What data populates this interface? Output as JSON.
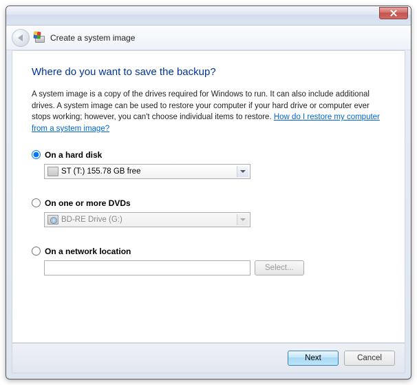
{
  "window": {
    "title": "Create a system image"
  },
  "main": {
    "heading": "Where do you want to save the backup?",
    "description_plain": "A system image is a copy of the drives required for Windows to run. It can also include additional drives. A system image can be used to restore your computer if your hard drive or computer ever stops working; however, you can't choose individual items to restore. ",
    "description_link": "How do I restore my computer from a system image?"
  },
  "options": {
    "hard_disk": {
      "label": "On a hard disk",
      "selected": true,
      "value": "ST (T:)  155.78 GB free"
    },
    "dvd": {
      "label": "On one or more DVDs",
      "selected": false,
      "value": "BD-RE Drive (G:)"
    },
    "network": {
      "label": "On a network location",
      "selected": false,
      "value": "",
      "select_button": "Select..."
    }
  },
  "footer": {
    "next": "Next",
    "cancel": "Cancel"
  }
}
